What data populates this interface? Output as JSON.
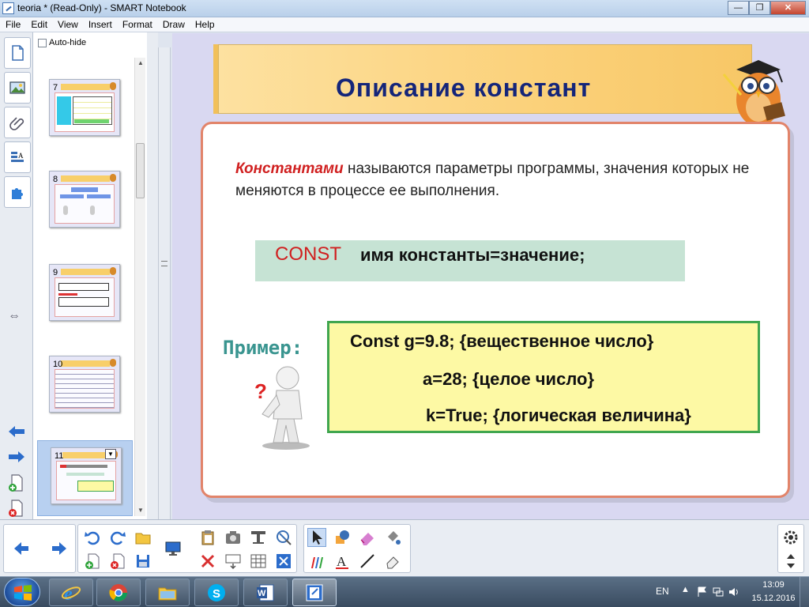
{
  "window": {
    "title": "teoria * (Read-Only) - SMART Notebook"
  },
  "menu": [
    "File",
    "Edit",
    "View",
    "Insert",
    "Format",
    "Draw",
    "Help"
  ],
  "sorter": {
    "autohide_label": "Auto-hide",
    "pages": [
      {
        "num": "7"
      },
      {
        "num": "8"
      },
      {
        "num": "9"
      },
      {
        "num": "10"
      },
      {
        "num": "11"
      }
    ],
    "selected_page": "11"
  },
  "slide": {
    "title": "Описание констант",
    "definition_keyword": "Константами",
    "definition_rest": " называются параметры программы, значения которых не меняются в процессе ее выполнения.",
    "const_keyword": "CONST",
    "const_rest": "имя константы=значение;",
    "example_label": "Пример:",
    "example_lines": [
      "Const g=9.8; {вещественное число}",
      "a=28; {целое число}",
      "k=True; {логическая величина}"
    ]
  },
  "taskbar": {
    "language": "EN",
    "time": "13:09",
    "date": "15.12.2016"
  },
  "colors": {
    "title_text": "#14257a",
    "keyword_red": "#d02020",
    "const_box": "#c6e3d4",
    "example_box": "#fdf9a4",
    "example_border": "#40a64f",
    "content_border": "#e2846a",
    "canvas_bg": "#d9d8f1"
  }
}
